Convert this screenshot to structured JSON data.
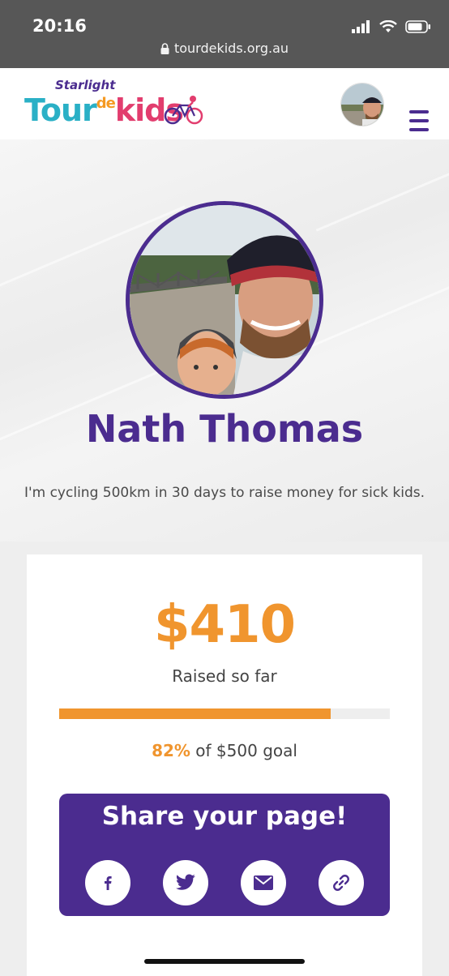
{
  "status_bar": {
    "time": "20:16",
    "url": "tourdekids.org.au"
  },
  "header": {
    "logo": {
      "starlight": "Starlight",
      "tour": "Tour",
      "de": "de",
      "kids": "kids"
    },
    "avatar_icon": "user-avatar",
    "menu_icon": "hamburger-menu"
  },
  "profile": {
    "name": "Nath Thomas",
    "bio": "I'm cycling 500km in 30 days to raise money for sick kids."
  },
  "fundraising": {
    "amount": "$410",
    "raised_label": "Raised so far",
    "progress_fraction": 0.82,
    "percent": "82%",
    "goal_text": "of $500 goal"
  },
  "share": {
    "title": "Share your page!",
    "icons": [
      "facebook-icon",
      "twitter-icon",
      "email-icon",
      "link-icon"
    ]
  },
  "colors": {
    "brand_purple": "#4b2c8f",
    "accent_orange": "#f0952e",
    "logo_teal": "#2ab0c6",
    "logo_pink": "#e23d6e"
  }
}
